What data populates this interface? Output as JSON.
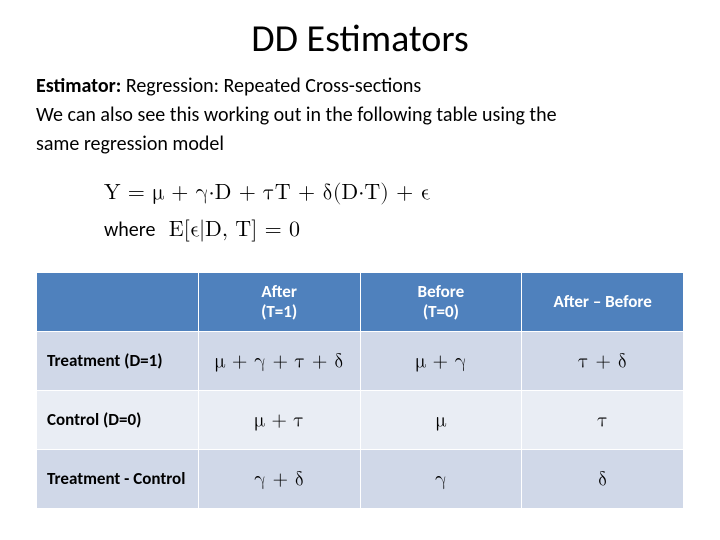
{
  "title": "DD Estimators",
  "subtitle": {
    "bold": "Estimator:",
    "rest": " Regression: Repeated Cross-sections"
  },
  "body_lines": [
    "We can also see this working out in the following table using the",
    "same regression model"
  ],
  "equation": {
    "main": "Y = μ + γ·D + τT + δ(D·T) + ϵ",
    "where_label": "where",
    "where_expr": "E[ϵ|D, T] = 0"
  },
  "table": {
    "headers": {
      "corner": "",
      "after": "After\n(T=1)",
      "before": "Before\n(T=0)",
      "diff": "After – Before"
    },
    "rows": [
      {
        "label": "Treatment (D=1)",
        "after": "μ + γ + τ + δ",
        "before": "μ + γ",
        "diff": "τ + δ"
      },
      {
        "label": "Control (D=0)",
        "after": "μ + τ",
        "before": "μ",
        "diff": "τ"
      },
      {
        "label": "Treatment - Control",
        "after": "γ + δ",
        "before": "γ",
        "diff": "δ"
      }
    ]
  }
}
